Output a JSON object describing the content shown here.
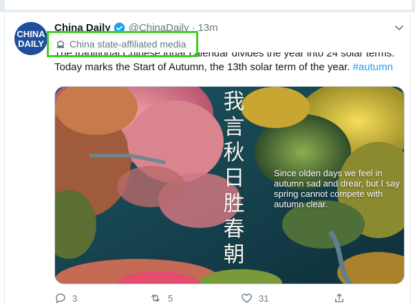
{
  "tweet": {
    "author_name": "China Daily",
    "handle": "@ChinaDaily",
    "separator": "·",
    "time": "13m",
    "avatar_text_line1": "CHINA",
    "avatar_text_line2": "DAILY",
    "state_label": "China state-affiliated media",
    "text_line1": "The traditional Chinese lunar calendar divides the year into 24 solar terms.",
    "text_line2": "Today marks the Start of Autumn, the 13th solar term of the year.",
    "hashtag": "#autumn",
    "media": {
      "poem_chars": [
        "我",
        "言",
        "秋",
        "日",
        "胜",
        "春",
        "朝"
      ],
      "caption": "Since olden days we feel in autumn sad and drear, but I say spring cannot compete with autumn clear."
    },
    "actions": {
      "reply_count": "3",
      "retweet_count": "5",
      "like_count": "31"
    }
  },
  "colors": {
    "accent": "#1da1f2",
    "highlight_box": "#3bd21e",
    "secondary_text": "#657786",
    "avatar_bg": "#1f4e9c"
  },
  "icons": [
    "verified-badge-icon",
    "chevron-down-icon",
    "building-icon",
    "reply-icon",
    "retweet-icon",
    "like-icon",
    "share-icon"
  ]
}
